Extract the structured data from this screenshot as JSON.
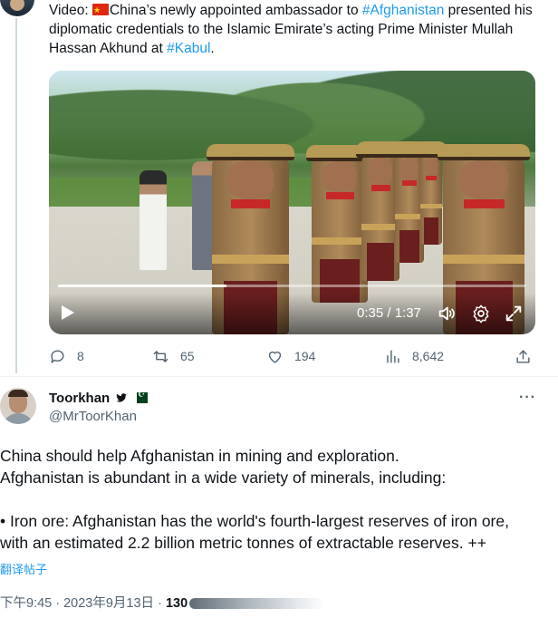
{
  "tweet1": {
    "text_prefix": "Video: ",
    "flag": "🇨🇳",
    "text_part1": "China’s newly appointed ambassador to ",
    "hashtag1": "#Afghanistan",
    "text_part2": " presented his diplomatic credentials to the Islamic Emirate’s acting Prime Minister Mullah Hassan Akhund at ",
    "hashtag2": "#Kabul",
    "text_end": ".",
    "video": {
      "time_display": "0:35 / 1:37",
      "progress_fraction": 0.36
    },
    "actions": {
      "reply_count": "8",
      "retweet_count": "65",
      "like_count": "194",
      "view_count": "8,642"
    }
  },
  "tweet2": {
    "display_name": "Toorkhan",
    "handle": "@MrToorKhan",
    "body_line1": "China should help Afghanistan in mining and exploration.",
    "body_line2": "Afghanistan is abundant in a wide variety of minerals, including:",
    "body_line3": "• Iron ore: Afghanistan has the world's fourth-largest reserves of iron ore,",
    "body_line4": "with an estimated 2.2 billion metric tonnes of extractable reserves. ++",
    "translate_link": "翻译帖子",
    "timestamp": "下午9:45 · 2023年9月13日 · ",
    "views_partial": "130"
  },
  "colors": {
    "accent": "#1d9bf0",
    "text": "#0f1419",
    "muted": "#536471",
    "divider": "#eff3f4"
  },
  "icons": [
    "reply-icon",
    "retweet-icon",
    "like-icon",
    "views-icon",
    "share-icon",
    "play-icon",
    "volume-icon",
    "settings-icon",
    "fullscreen-icon",
    "more-icon",
    "twitter-bird-icon"
  ]
}
